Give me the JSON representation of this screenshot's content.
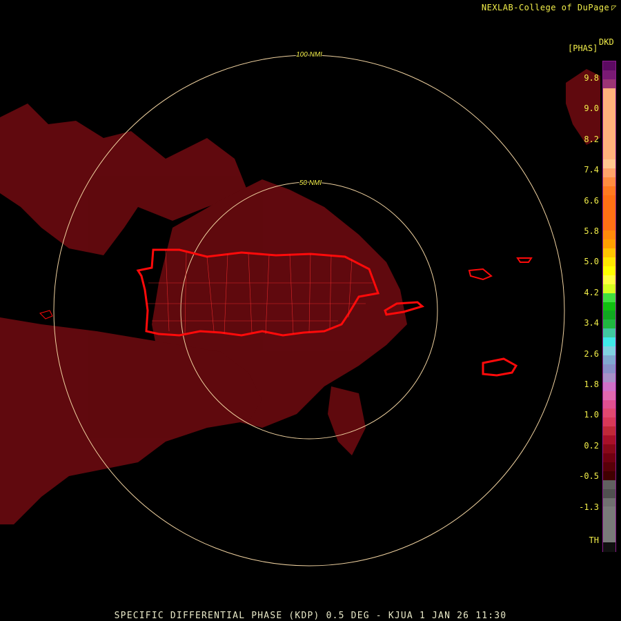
{
  "header": {
    "credit": "NEXLAB-College of DuPage",
    "credit_mark": "◸"
  },
  "footer": {
    "caption": "SPECIFIC DIFFERENTIAL PHASE (KDP) 0.5 DEG - KJUA 1 JAN 26 11:30"
  },
  "range_rings": [
    {
      "label": "50 NMI",
      "range_nmi": 50
    },
    {
      "label": "100 NMI",
      "range_nmi": 100
    }
  ],
  "legend": {
    "product": "DKD",
    "units": "[PHAS]",
    "ticks": [
      "9.8",
      "9.0",
      "8.2",
      "7.4",
      "6.6",
      "5.8",
      "5.0",
      "4.2",
      "3.4",
      "2.6",
      "1.8",
      "1.0",
      "0.2",
      "-0.5",
      "-1.3",
      "TH"
    ],
    "colors": [
      "#5c0a62",
      "#7a1a74",
      "#9c3574",
      "#ffb27c",
      "#ffb27c",
      "#ffb27c",
      "#ffb27c",
      "#ffb27c",
      "#ffb27c",
      "#ffb27c",
      "#ffb27c",
      "#ffc890",
      "#ffa46a",
      "#ff8c40",
      "#ff7a20",
      "#ff7014",
      "#ff7014",
      "#ff7014",
      "#ff7014",
      "#ff8a0a",
      "#ffa000",
      "#ffc400",
      "#ffe600",
      "#ffff00",
      "#ffff40",
      "#d6ff20",
      "#40e040",
      "#10c010",
      "#10a820",
      "#20b840",
      "#40c8a0",
      "#40e8e8",
      "#80d0e0",
      "#80a8d0",
      "#8890c8",
      "#a890c8",
      "#d070c8",
      "#e068b0",
      "#e05090",
      "#e04870",
      "#d83858",
      "#c02838",
      "#a81028",
      "#880818",
      "#700010",
      "#580008",
      "#400000",
      "#606060",
      "#505050",
      "#707070",
      "#7a7a7a",
      "#7a7a7a",
      "#7a7a7a",
      "#7a7a7a",
      "#101010"
    ],
    "line_color": "#8d1a8d"
  },
  "colors": {
    "ring": "#f0d2a0",
    "coastline": "#ff0a0a",
    "echo": "#6a0a0f",
    "label": "#f2ee4a"
  }
}
